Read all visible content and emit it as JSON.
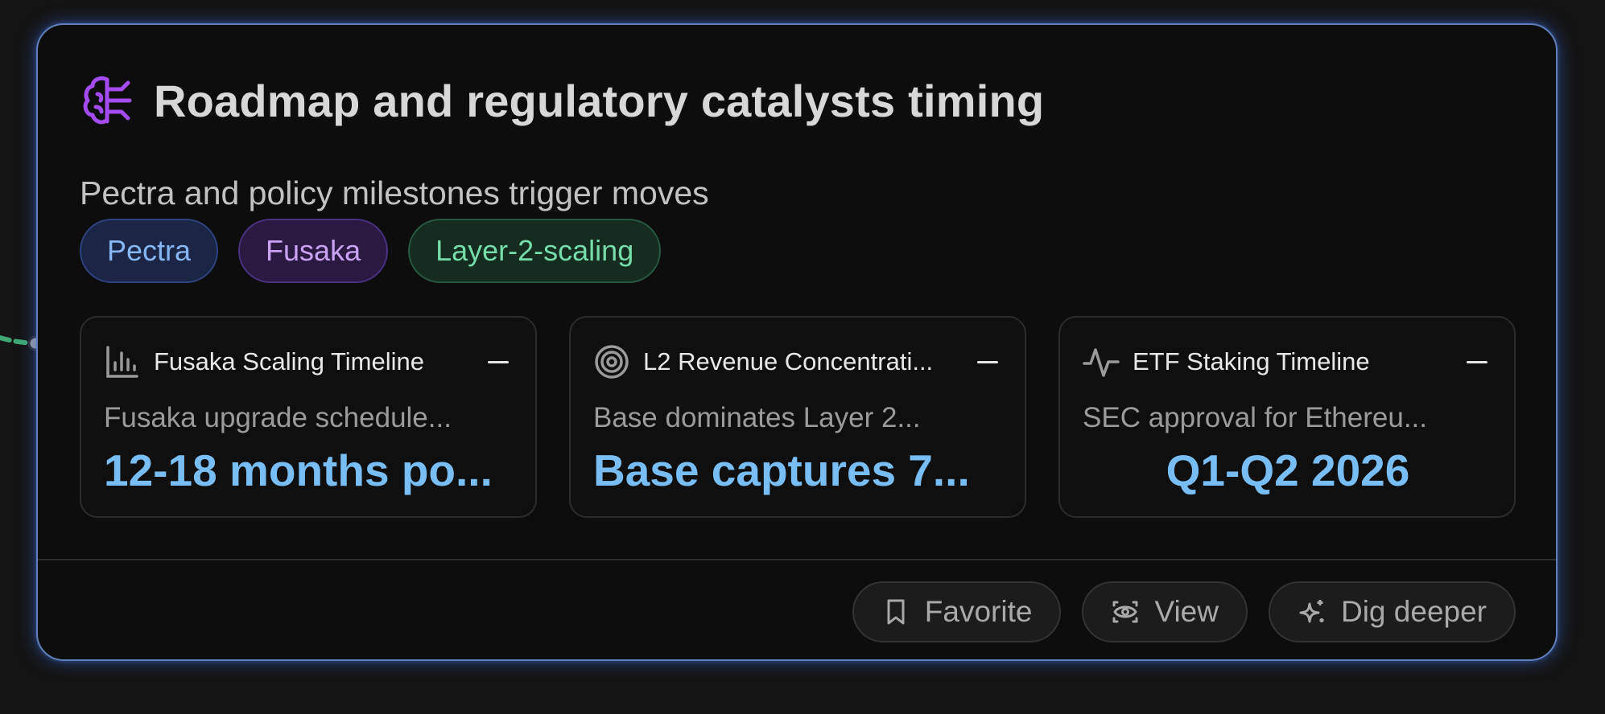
{
  "card": {
    "title": "Roadmap and regulatory catalysts timing",
    "subtitle": "Pectra and policy milestones trigger moves",
    "title_icon": "brain-icon",
    "accent_color": "#a44bf2",
    "border_color": "#5e7fb8"
  },
  "tags": [
    {
      "label": "Pectra",
      "color": "#86b6f4"
    },
    {
      "label": "Fusaka",
      "color": "#c9a2f2"
    },
    {
      "label": "Layer-2-scaling",
      "color": "#76dcaa"
    }
  ],
  "metrics": [
    {
      "icon": "bar-chart-icon",
      "title": "Fusaka Scaling Timeline",
      "description": "Fusaka upgrade schedule...",
      "value": "12-18 months po..."
    },
    {
      "icon": "target-icon",
      "title": "L2 Revenue Concentrati...",
      "description": "Base dominates Layer 2...",
      "value": "Base captures 7..."
    },
    {
      "icon": "activity-icon",
      "title": "ETF Staking Timeline",
      "description": "SEC approval for Ethereu...",
      "value": "Q1-Q2 2026"
    }
  ],
  "actions": {
    "favorite": "Favorite",
    "view": "View",
    "dig_deeper": "Dig deeper"
  },
  "value_color": "#78bef5"
}
